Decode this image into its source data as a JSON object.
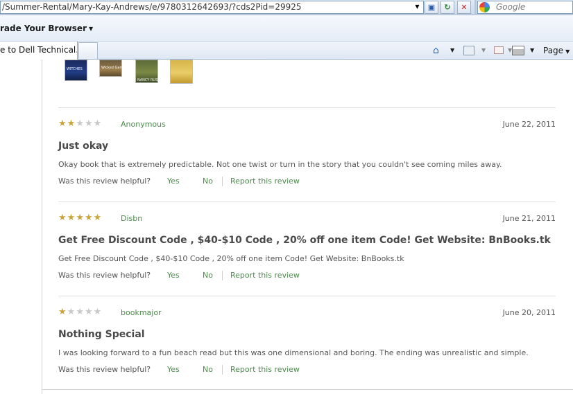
{
  "browser": {
    "address": "/Summer-Rental/Mary-Kay-Andrews/e/9780312642693/?cds2Pid=29925",
    "search_placeholder": "Google",
    "upgrade_link": "rade Your Browser",
    "active_tab": "e to Dell Technical...",
    "page_menu": "Page"
  },
  "icons": {
    "compat": "compatibility-view-icon",
    "refresh": "refresh-icon",
    "stop": "stop-icon",
    "search_provider": "google-icon",
    "home": "home-icon",
    "feeds": "feeds-icon",
    "mail": "read-mail-icon",
    "print": "print-icon"
  },
  "colors": {
    "link_green": "#4b8a4b",
    "star_gold": "#c9a43b",
    "star_empty": "#c8c8c8"
  },
  "related_books": [
    {
      "title_text": "WITCHES"
    },
    {
      "title_text": "Wicked Game"
    },
    {
      "title_text": "NANCY RUSH"
    },
    {
      "title_text": ""
    }
  ],
  "reviews": [
    {
      "rating": 2,
      "reviewer": "Anonymous",
      "date": "June 22, 2011",
      "headline": "Just okay",
      "body": "Okay book that is extremely predictable. Not one twist or turn in the story that you couldn't see coming miles away.",
      "helpful_question": "Was this review helpful?",
      "yes": "Yes",
      "no": "No",
      "report": "Report this review"
    },
    {
      "rating": 5,
      "reviewer": "Disbn",
      "date": "June 21, 2011",
      "headline": "Get Free Discount Code , $40-$10 Code , 20% off one item Code! Get Website: BnBooks.tk",
      "body": "Get Free Discount Code , $40-$10 Code , 20% off one item Code! Get Website: BnBooks.tk",
      "helpful_question": "Was this review helpful?",
      "yes": "Yes",
      "no": "No",
      "report": "Report this review"
    },
    {
      "rating": 1,
      "reviewer": "bookmajor",
      "date": "June 20, 2011",
      "headline": "Nothing Special",
      "body": "I was looking forward to a fun beach read but this was one dimensional and boring. The ending was unrealistic and simple.",
      "helpful_question": "Was this review helpful?",
      "yes": "Yes",
      "no": "No",
      "report": "Report this review"
    }
  ]
}
